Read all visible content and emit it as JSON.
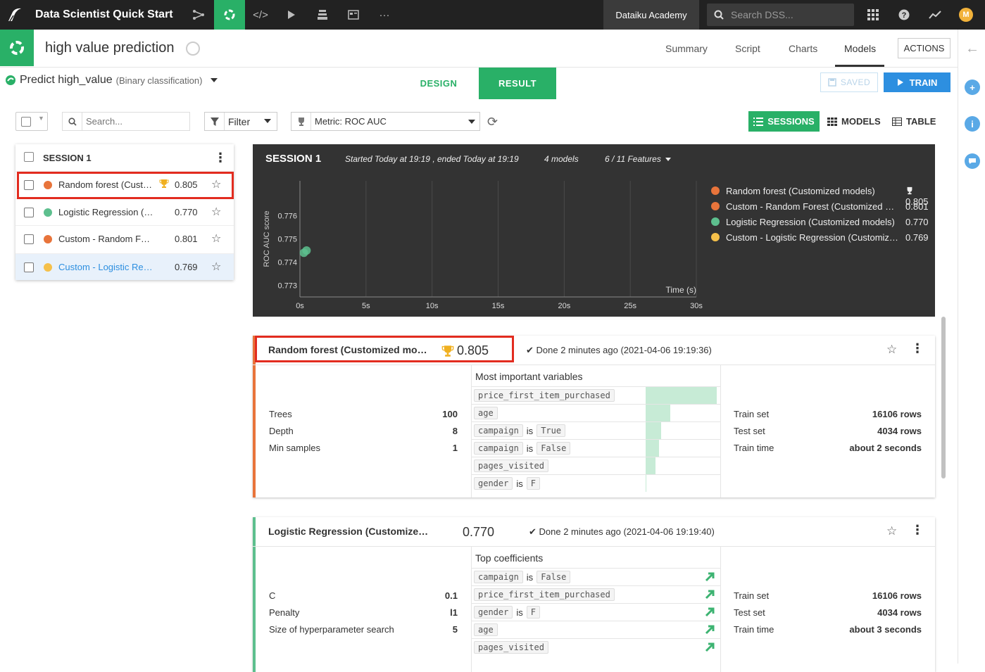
{
  "topbar": {
    "project_name": "Data Scientist Quick Start",
    "academy_label": "Dataiku Academy",
    "search_placeholder": "Search DSS...",
    "avatar_initial": "M"
  },
  "header": {
    "title": "high value prediction",
    "tabs": [
      "Summary",
      "Script",
      "Charts",
      "Models"
    ],
    "active_tab": "Models",
    "actions_label": "ACTIONS"
  },
  "subheader": {
    "predict_label": "Predict high_value",
    "predict_type": "(Binary classification)",
    "design_tab": "DESIGN",
    "result_tab": "RESULT",
    "saved_label": "SAVED",
    "train_label": "TRAIN"
  },
  "toolbar": {
    "search_placeholder": "Search...",
    "filter_label": "Filter",
    "metric_label": "Metric: ROC AUC",
    "view_sessions": "SESSIONS",
    "view_models": "MODELS",
    "view_table": "TABLE"
  },
  "left_panel": {
    "session_label": "SESSION 1",
    "models": [
      {
        "name": "Random forest (Customized models)",
        "score": "0.805",
        "color": "#e8743b",
        "best": true
      },
      {
        "name": "Logistic Regression (Customized models)",
        "score": "0.770",
        "color": "#5dbf8e",
        "best": false
      },
      {
        "name": "Custom - Random Forest (Customized models)",
        "score": "0.801",
        "color": "#e8743b",
        "best": false
      },
      {
        "name": "Custom - Logistic Regression (Customized models)",
        "score": "0.769",
        "color": "#f5c04a",
        "best": false
      }
    ]
  },
  "session_chart": {
    "title": "SESSION 1",
    "started": "Started Today at 19:19 , ended Today at 19:19",
    "models_count": "4 models",
    "features": "6 / 11 Features",
    "legend": [
      {
        "name": "Random forest (Customized models)",
        "score": "0.805",
        "color": "#e8743b",
        "best": true
      },
      {
        "name": "Custom - Random Forest (Customized models)",
        "score": "0.801",
        "color": "#e8743b",
        "best": false
      },
      {
        "name": "Logistic Regression (Customized models)",
        "score": "0.770",
        "color": "#5dbf8e",
        "best": false
      },
      {
        "name": "Custom - Logistic Regression (Customized models)",
        "score": "0.769",
        "color": "#f5c04a",
        "best": false
      }
    ]
  },
  "chart_data": {
    "type": "scatter",
    "title": "",
    "xlabel": "Time (s)",
    "ylabel": "ROC AUC score",
    "xlim": [
      0,
      30
    ],
    "ylim": [
      0.7725,
      0.7775
    ],
    "x_ticks": [
      "0s",
      "5s",
      "10s",
      "15s",
      "20s",
      "25s",
      "30s"
    ],
    "x_tick_values": [
      0,
      5,
      10,
      15,
      20,
      25,
      30
    ],
    "y_ticks": [
      "0.773",
      "0.774",
      "0.775",
      "0.776"
    ],
    "y_tick_values": [
      0.773,
      0.774,
      0.775,
      0.776
    ],
    "series": [
      {
        "color": "#5dbf8e",
        "points": [
          [
            0.5,
            0.7745
          ],
          [
            0.3,
            0.7744
          ]
        ]
      }
    ]
  },
  "card1": {
    "name": "Random forest (Customized models)",
    "score": "0.805",
    "done": "Done 2 minutes ago (2021-04-06 19:19:36)",
    "color": "#e8743b",
    "params": [
      {
        "k": "Trees",
        "v": "100"
      },
      {
        "k": "Depth",
        "v": "8"
      },
      {
        "k": "Min samples",
        "v": "1"
      }
    ],
    "vars_title": "Most important variables",
    "vars": [
      {
        "feature": "price_first_item_purchased",
        "is": "",
        "value": "",
        "importance": 1.0
      },
      {
        "feature": "age",
        "is": "",
        "value": "",
        "importance": 0.35
      },
      {
        "feature": "campaign",
        "is": "is",
        "value": "True",
        "importance": 0.22
      },
      {
        "feature": "campaign",
        "is": "is",
        "value": "False",
        "importance": 0.19
      },
      {
        "feature": "pages_visited",
        "is": "",
        "value": "",
        "importance": 0.14
      },
      {
        "feature": "gender",
        "is": "is",
        "value": "F",
        "importance": 0.01
      }
    ],
    "stats": [
      {
        "k": "Train set",
        "v": "16106 rows"
      },
      {
        "k": "Test set",
        "v": "4034 rows"
      },
      {
        "k": "Train time",
        "v": "about 2 seconds"
      }
    ]
  },
  "card2": {
    "name": "Logistic Regression (Customized models)",
    "score": "0.770",
    "done": "Done 2 minutes ago (2021-04-06 19:19:40)",
    "color": "#5dbf8e",
    "params": [
      {
        "k": "C",
        "v": "0.1"
      },
      {
        "k": "Penalty",
        "v": "l1"
      },
      {
        "k": "Size of hyperparameter search",
        "v": "5"
      }
    ],
    "vars_title": "Top coefficients",
    "vars": [
      {
        "feature": "campaign",
        "is": "is",
        "value": "False"
      },
      {
        "feature": "price_first_item_purchased",
        "is": "",
        "value": ""
      },
      {
        "feature": "gender",
        "is": "is",
        "value": "F"
      },
      {
        "feature": "age",
        "is": "",
        "value": ""
      },
      {
        "feature": "pages_visited",
        "is": "",
        "value": ""
      }
    ],
    "stats": [
      {
        "k": "Train set",
        "v": "16106 rows"
      },
      {
        "k": "Test set",
        "v": "4034 rows"
      },
      {
        "k": "Train time",
        "v": "about 3 seconds"
      }
    ]
  }
}
